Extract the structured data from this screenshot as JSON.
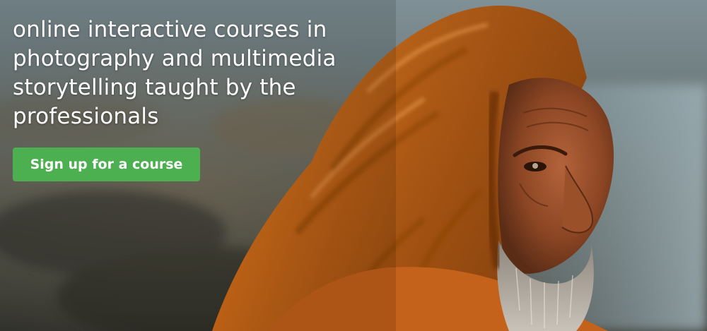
{
  "hero": {
    "headline": "online interactive courses in photography and multimedia storytelling taught by the professionals",
    "cta_label": "Sign up for a course",
    "photo": "portrait-man-orange-shawl"
  },
  "colors": {
    "cta_background": "#4caf50",
    "headline_text": "#ffffff",
    "shawl_orange": "#e07a1f"
  }
}
